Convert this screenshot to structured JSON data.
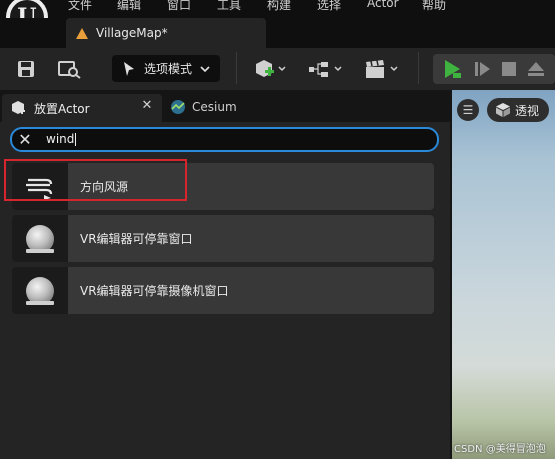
{
  "menubar": {
    "items": [
      "文件",
      "编辑",
      "窗口",
      "工具",
      "构建",
      "选择",
      "Actor",
      "帮助"
    ]
  },
  "document_tab": {
    "title": "VillageMap*"
  },
  "toolbar": {
    "mode_label": "选项模式"
  },
  "panel": {
    "tabs": [
      {
        "label": "放置Actor"
      },
      {
        "label": "Cesium"
      }
    ],
    "close_glyph": "✕",
    "search": {
      "value": "wind",
      "clear_glyph": "✕"
    },
    "results": [
      {
        "label": "方向风源",
        "icon": "wind-source-icon"
      },
      {
        "label": "VR编辑器可停靠窗口",
        "icon": "sphere-icon"
      },
      {
        "label": "VR编辑器可停靠摄像机窗口",
        "icon": "sphere-icon"
      }
    ]
  },
  "viewport": {
    "perspective_label": "透视",
    "menu_glyph": "☰"
  },
  "watermark": "CSDN @美得冒泡泡",
  "colors": {
    "accent": "#2a89d9",
    "highlight": "#d7252f",
    "play": "#3fb33f",
    "warning": "#e9a03a"
  }
}
